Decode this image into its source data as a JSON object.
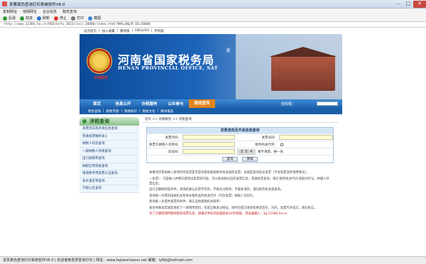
{
  "window": {
    "title": "发票真伪查询打印系统软件V6.0",
    "controls": [
      "–",
      "□",
      "✕"
    ]
  },
  "menu": [
    "复制网址",
    "他网网址",
    "企业信息",
    "税务查询"
  ],
  "toolbar": [
    {
      "label": "后退",
      "icon": "back-icon",
      "color": "#2e9b3b"
    },
    {
      "label": "前进",
      "icon": "forward-icon",
      "color": "#2e9b3b"
    },
    {
      "label": "刷新",
      "icon": "refresh-icon",
      "color": "#2b74c9"
    },
    {
      "label": "停止",
      "icon": "stop-icon",
      "color": "#d83a2a"
    },
    {
      "label": "打印",
      "icon": "print-icon",
      "color": "#777777"
    },
    {
      "label": "截图",
      "icon": "screenshot-icon",
      "color": "#3b8bd6"
    }
  ],
  "address": "http://www.12366.ha.cn/003/bsfw_2021/cxcs_20000/index.html?NVG=0&LM_ID=30000",
  "site": {
    "toplinks": [
      "设为首页",
      "|",
      "加入收藏",
      "|",
      "繁体版",
      "|",
      "ENGLISH",
      "|",
      "手机版"
    ],
    "title": "河南省国家税务局",
    "subtitle": "HENAN PROVINCIAL OFFICE, SAT",
    "emblem_text": "中国税务",
    "banner_note": "发",
    "nav": [
      "首页",
      "信息公开",
      "办税服务",
      "公众参与",
      "税收宣传"
    ],
    "nav_active": 4,
    "login_label": "密码框：",
    "subnav": [
      "税务查询",
      "|",
      "税收专题",
      "|",
      "税收知识",
      "|",
      "税收文化",
      "|",
      "媒体报道"
    ]
  },
  "sidebar": {
    "title": "涉税查询",
    "items": [
      "发票流向及开具信息查询",
      "普通发票抽奖录入",
      "纳税人状态查询",
      "一般纳税人资格查询",
      "出口退税率查询",
      "纳税信用等级查询",
      "增值税专用发票认证查询",
      "系水查定率查询",
      "欠税公告查询"
    ]
  },
  "breadcrumb": "首页 >> 办税服务 >> 涉税查询",
  "form": {
    "title": "发票流向及开具信息查询",
    "invoice_code_label": "发票代码：",
    "invoice_number_label": "发票号码：",
    "taxpayer_id_label": "收票方纳税人识别号：",
    "tax_authority_label": "税务机关代开：",
    "captcha_label": "验证码：",
    "captcha_value": "3 5 4",
    "refresh_label": "看不清楚，换一张",
    "query_button": "查询",
    "reset_button": "重填"
  },
  "notes": [
    "本模块仅帮助纳入查询所持发票是否是河南省国家税务局发放的发票，也就是查询验证发票（不含发票流转领用情况）。",
    "一发票）：凡是纳入并费实提和出发票的内容，可以查询相对应的发票信息；普通发票查询，请在'税务机关代开'选框内打勾，并输入开票信息。",
    "出口全额网控提条件，查询结果与实际不符的，不要支付款项；不能查询的，请在税务机关或查询。",
    "查询统一开票的国家机关及各办税机关的机关代开（代开发票）纳税人识别号。",
    "查询统一多提供发票的条件、请与当地国税机关联系！",
    "查询书真发票或结查验了一期领用资料，有就正数发过网址，同时在提交查验结果前签名，对内，发票代开成交，请先核实。",
    "为了方便您随时随地查验发票信息，请通过手机浏览器登录3G手机版，浏览器输入：3g.12366.ha.cn"
  ],
  "status": "发票真伪查询打印系统软件V6.0 | 欢迎使用发票查询打印 | 网址：www.fapiaochaxun.net 邮箱：lyfbt@hotmail.com"
}
